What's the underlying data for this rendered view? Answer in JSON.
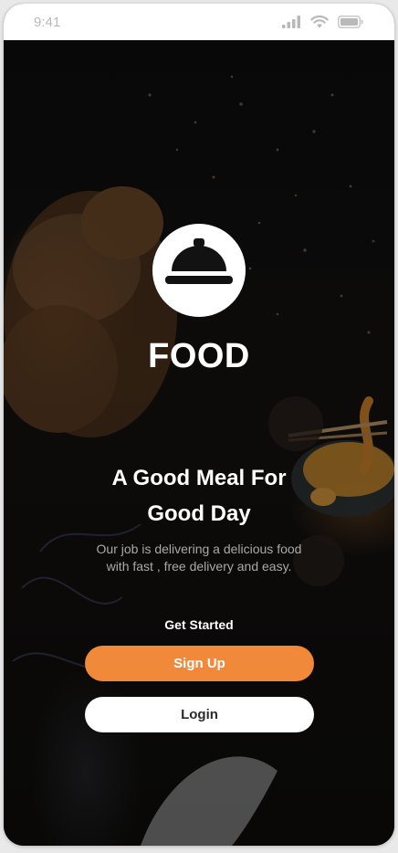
{
  "status_bar": {
    "time": "9:41",
    "icons": [
      "signal-icon",
      "wifi-icon",
      "battery-icon"
    ]
  },
  "brand": {
    "name": "FOOD",
    "logo_icon": "cloche-icon"
  },
  "headline": {
    "line1": "A Good Meal For",
    "line2": "Good Day"
  },
  "subtext": {
    "line1": "Our job is delivering a delicious food",
    "line2": "with fast , free delivery and easy."
  },
  "cta": {
    "label": "Get Started",
    "signup_label": "Sign Up",
    "login_label": "Login"
  },
  "colors": {
    "accent": "#f0893a",
    "background": "#111111",
    "text": "#ffffff",
    "muted_text": "#a9a9a9"
  }
}
